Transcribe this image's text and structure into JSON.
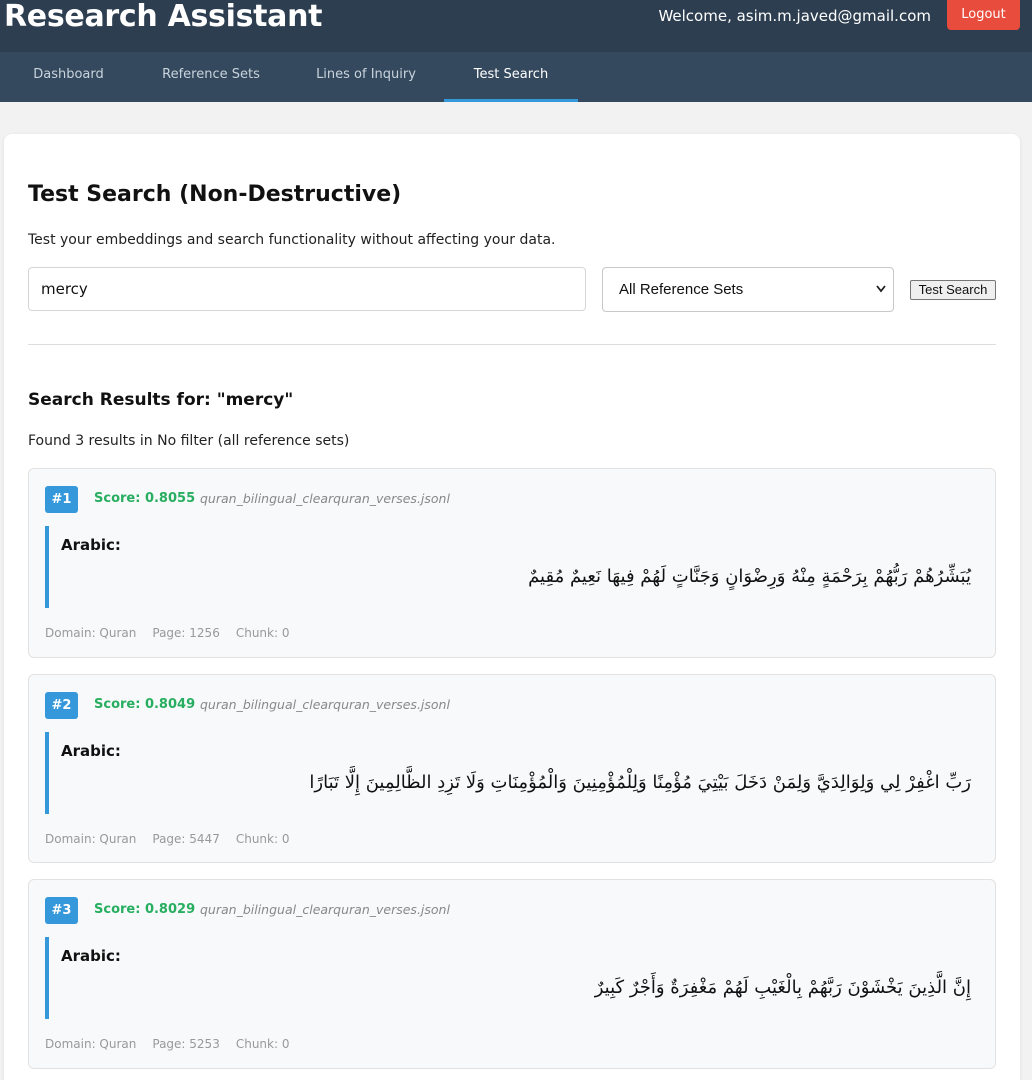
{
  "header": {
    "app_title": "Research Assistant",
    "welcome": "Welcome, asim.m.javed@gmail.com",
    "logout_label": "Logout"
  },
  "nav": {
    "items": [
      {
        "label": "Dashboard"
      },
      {
        "label": "Reference Sets"
      },
      {
        "label": "Lines of Inquiry"
      },
      {
        "label": "Test Search",
        "active": true
      }
    ]
  },
  "main": {
    "title": "Test Search (Non-Destructive)",
    "subtitle": "Test your embeddings and search functionality without affecting your data.",
    "search": {
      "value": "mercy",
      "placeholder": ""
    },
    "filter": {
      "selected": "All Reference Sets"
    },
    "test_button_label": "Test Search",
    "results_title": "Search Results for: \"mercy\"",
    "results_summary": "Found 3 results in No filter (all reference sets)"
  },
  "results": [
    {
      "rank": "#1",
      "score": "Score: 0.8055",
      "source": "quran_bilingual_clearquran_verses.jsonl",
      "label": "Arabic:",
      "text": "يُبَشِّرُهُمْ رَبُّهُمْ بِرَحْمَةٍ مِنْهُ وَرِضْوَانٍ وَجَنَّاتٍ لَهُمْ فِيهَا نَعِيمٌ مُقِيمٌ",
      "domain": "Domain: Quran",
      "page": "Page: 1256",
      "chunk": "Chunk: 0"
    },
    {
      "rank": "#2",
      "score": "Score: 0.8049",
      "source": "quran_bilingual_clearquran_verses.jsonl",
      "label": "Arabic:",
      "text": "رَبِّ اغْفِرْ لِي وَلِوَالِدَيَّ وَلِمَنْ دَخَلَ بَيْتِيَ مُؤْمِنًا وَلِلْمُؤْمِنِينَ وَالْمُؤْمِنَاتِ وَلَا تَزِدِ الظَّالِمِينَ إِلَّا تَبَارًا",
      "domain": "Domain: Quran",
      "page": "Page: 5447",
      "chunk": "Chunk: 0"
    },
    {
      "rank": "#3",
      "score": "Score: 0.8029",
      "source": "quran_bilingual_clearquran_verses.jsonl",
      "label": "Arabic:",
      "text": "إِنَّ الَّذِينَ يَخْشَوْنَ رَبَّهُمْ بِالْغَيْبِ لَهُمْ مَغْفِرَةٌ وَأَجْرٌ كَبِيرٌ",
      "domain": "Domain: Quran",
      "page": "Page: 5253",
      "chunk": "Chunk: 0"
    }
  ],
  "colors": {
    "header_bg": "#2c3e50",
    "nav_bg": "#34495e",
    "accent": "#3498db",
    "logout": "#e74c3c",
    "score": "#27ae60"
  }
}
